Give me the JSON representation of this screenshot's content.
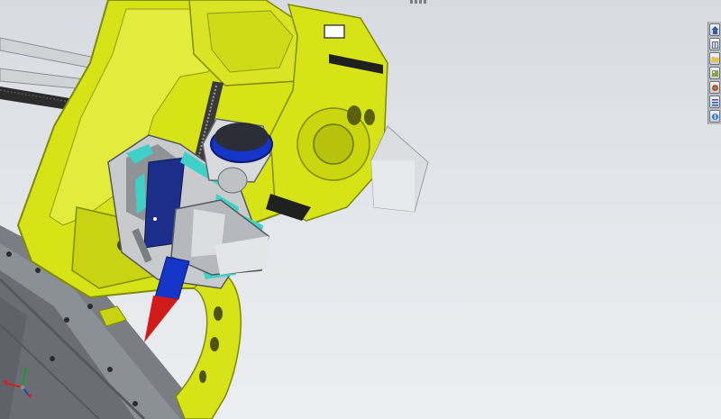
{
  "viewport": {
    "background_top": "#d7dbe1",
    "background_bottom": "#eceef1"
  },
  "model_colors": {
    "frame_yellow": "#d6e316",
    "frame_yellow_shadow": "#a9b40e",
    "frame_yellow_light": "#e6ef45",
    "carriage_gray": "#c7c9cc",
    "carriage_dark": "#8e9296",
    "accent_cyan": "#3fd0c8",
    "motor_blue": "#1534c8",
    "motor_cap": "#2b2e36",
    "nozzle_red": "#d11a1a",
    "rod_gray": "#d4d6d8",
    "belt_dark": "#2a2a2a",
    "bed_gray": "#6f7378"
  },
  "task_pane": {
    "icons": [
      "home-icon",
      "parts-library-icon",
      "folder-icon",
      "view-palette-icon",
      "appearances-icon",
      "custom-properties-icon",
      "resources-icon"
    ]
  },
  "reference_triad": {
    "axes": [
      "x-axis",
      "y-axis",
      "z-axis"
    ],
    "colors": [
      "#d0202a",
      "#1a9a2a",
      "#1f3fd0"
    ]
  }
}
